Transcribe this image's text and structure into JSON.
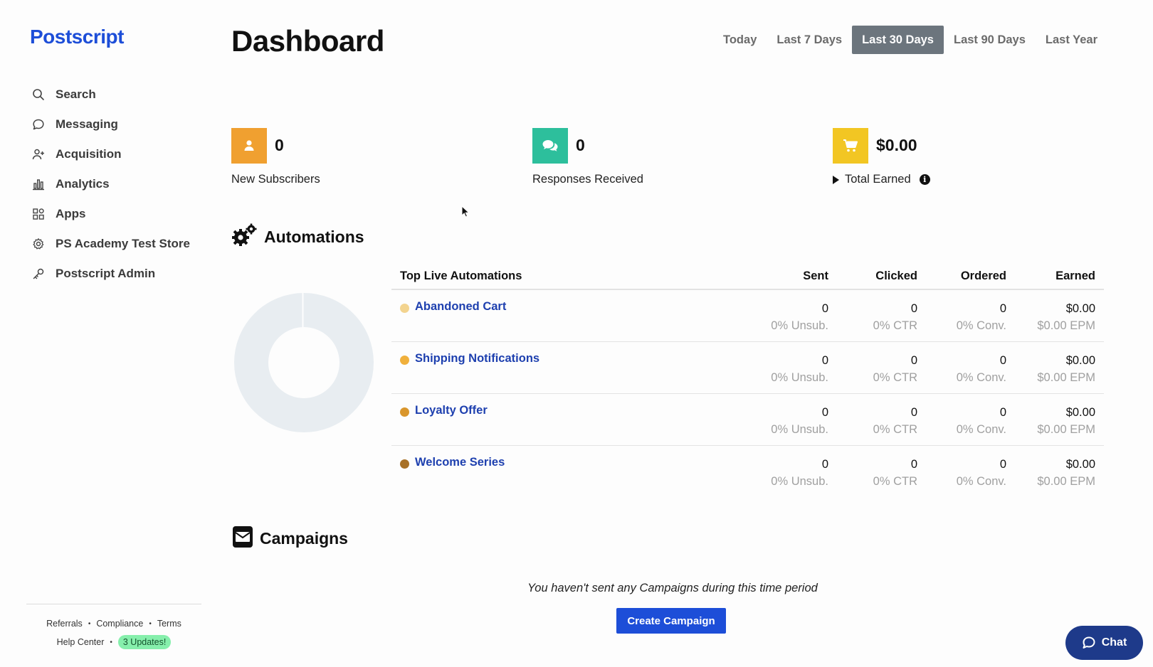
{
  "brand": {
    "name": "Postscript",
    "accent": "#1d4ed8"
  },
  "sidebar": {
    "items": [
      {
        "label": "Search",
        "icon": "search-icon"
      },
      {
        "label": "Messaging",
        "icon": "chat-bubble-icon"
      },
      {
        "label": "Acquisition",
        "icon": "user-plus-icon"
      },
      {
        "label": "Analytics",
        "icon": "bar-chart-icon"
      },
      {
        "label": "Apps",
        "icon": "apps-grid-icon"
      },
      {
        "label": "PS Academy Test Store",
        "icon": "gear-icon"
      },
      {
        "label": "Postscript Admin",
        "icon": "key-icon"
      }
    ],
    "footer": {
      "referrals": "Referrals",
      "compliance": "Compliance",
      "terms": "Terms",
      "help_center": "Help Center",
      "updates_badge": "3 Updates!",
      "separator": "•"
    }
  },
  "header": {
    "title": "Dashboard",
    "ranges": [
      "Today",
      "Last 7 Days",
      "Last 30 Days",
      "Last 90 Days",
      "Last Year"
    ],
    "active_range": "Last 30 Days"
  },
  "stats": {
    "new_subscribers": {
      "value": "0",
      "label": "New Subscribers",
      "icon": "user-icon",
      "color": "#f0a030"
    },
    "responses_received": {
      "value": "0",
      "label": "Responses Received",
      "icon": "comments-icon",
      "color": "#2dbf9c"
    },
    "total_earned": {
      "value": "$0.00",
      "label": "Total Earned",
      "icon": "cart-icon",
      "color": "#f2c623"
    }
  },
  "automations": {
    "title": "Automations",
    "table_headers": {
      "name": "Top Live Automations",
      "sent": "Sent",
      "clicked": "Clicked",
      "ordered": "Ordered",
      "earned": "Earned"
    },
    "rows": [
      {
        "name": "Abandoned Cart",
        "dot_color": "#f3d48f",
        "sent": "0",
        "unsub": "0% Unsub.",
        "clicked": "0",
        "ctr": "0% CTR",
        "ordered": "0",
        "conv": "0% Conv.",
        "earned": "$0.00",
        "epm": "$0.00 EPM"
      },
      {
        "name": "Shipping Notifications",
        "dot_color": "#f0b03c",
        "sent": "0",
        "unsub": "0% Unsub.",
        "clicked": "0",
        "ctr": "0% CTR",
        "ordered": "0",
        "conv": "0% Conv.",
        "earned": "$0.00",
        "epm": "$0.00 EPM"
      },
      {
        "name": "Loyalty Offer",
        "dot_color": "#d9962c",
        "sent": "0",
        "unsub": "0% Unsub.",
        "clicked": "0",
        "ctr": "0% CTR",
        "ordered": "0",
        "conv": "0% Conv.",
        "earned": "$0.00",
        "epm": "$0.00 EPM"
      },
      {
        "name": "Welcome Series",
        "dot_color": "#a77026",
        "sent": "0",
        "unsub": "0% Unsub.",
        "clicked": "0",
        "ctr": "0% CTR",
        "ordered": "0",
        "conv": "0% Conv.",
        "earned": "$0.00",
        "epm": "$0.00 EPM"
      }
    ]
  },
  "campaigns": {
    "title": "Campaigns",
    "empty_message": "You haven't sent any Campaigns during this time period",
    "create_button": "Create Campaign"
  },
  "chat": {
    "label": "Chat"
  }
}
